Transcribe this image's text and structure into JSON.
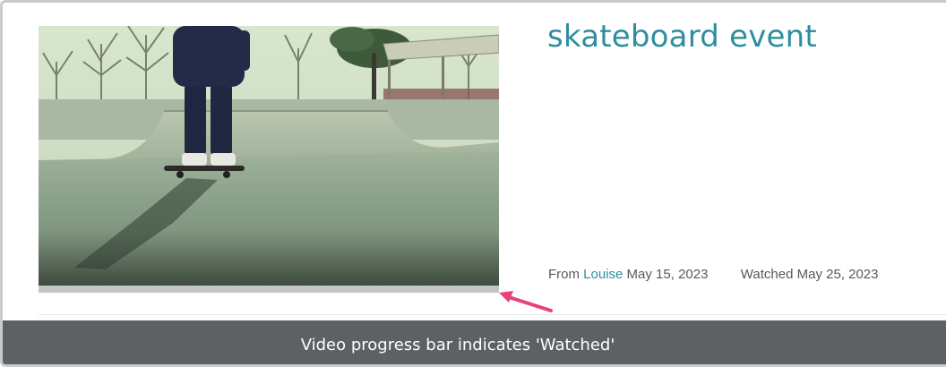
{
  "video": {
    "title": "skateboard event",
    "thumbnail_icon": "skatepark-video-thumbnail",
    "progress_fraction": 1.0,
    "from_label": "From",
    "author": "Louise",
    "shared_date": "May 15, 2023",
    "watched_label": "Watched May 25, 2023"
  },
  "annotation": {
    "caption": "Video progress bar indicates 'Watched'",
    "arrow_icon": "pink-arrow-icon",
    "arrow_color": "#e8417f"
  },
  "colors": {
    "accent": "#2f8da0",
    "caption_bg": "#5e6163"
  }
}
